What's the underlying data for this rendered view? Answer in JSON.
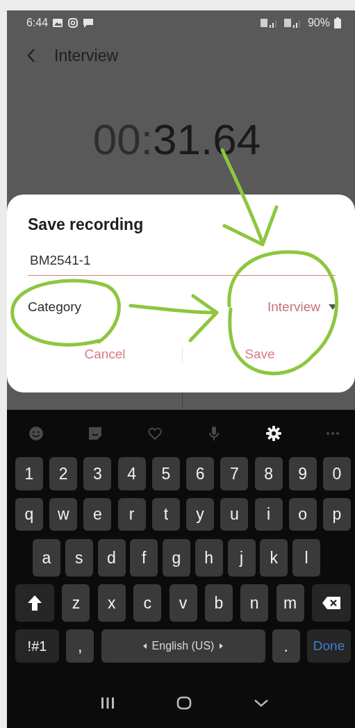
{
  "status_bar": {
    "time": "6:44",
    "battery": "90%"
  },
  "header": {
    "title": "Interview"
  },
  "timer": {
    "dim_part": "00:",
    "main_part": "31.64"
  },
  "dialog": {
    "title": "Save recording",
    "name_field": {
      "value": "BM2541-1"
    },
    "category": {
      "label": "Category",
      "value": "Interview"
    },
    "buttons": [
      "Cancel",
      "Save"
    ]
  },
  "keyboard": {
    "toolbar": [
      {
        "kind": "emoji",
        "highlighted": false
      },
      {
        "kind": "sticker",
        "highlighted": false
      },
      {
        "kind": "heart",
        "highlighted": false
      },
      {
        "kind": "mic",
        "highlighted": false
      },
      {
        "kind": "settings",
        "highlighted": true
      },
      {
        "kind": "more",
        "highlighted": false
      }
    ],
    "rows": [
      {
        "keys": [
          {
            "kind": "char",
            "label": "1"
          },
          {
            "kind": "char",
            "label": "2"
          },
          {
            "kind": "char",
            "label": "3"
          },
          {
            "kind": "char",
            "label": "4"
          },
          {
            "kind": "char",
            "label": "5"
          },
          {
            "kind": "char",
            "label": "6"
          },
          {
            "kind": "char",
            "label": "7"
          },
          {
            "kind": "char",
            "label": "8"
          },
          {
            "kind": "char",
            "label": "9"
          },
          {
            "kind": "char",
            "label": "0"
          }
        ]
      },
      {
        "keys": [
          {
            "kind": "char",
            "label": "q"
          },
          {
            "kind": "char",
            "label": "w"
          },
          {
            "kind": "char",
            "label": "e"
          },
          {
            "kind": "char",
            "label": "r"
          },
          {
            "kind": "char",
            "label": "t"
          },
          {
            "kind": "char",
            "label": "y"
          },
          {
            "kind": "char",
            "label": "u"
          },
          {
            "kind": "char",
            "label": "i"
          },
          {
            "kind": "char",
            "label": "o"
          },
          {
            "kind": "char",
            "label": "p"
          }
        ]
      },
      {
        "keys": [
          {
            "kind": "char",
            "label": "a"
          },
          {
            "kind": "char",
            "label": "s"
          },
          {
            "kind": "char",
            "label": "d"
          },
          {
            "kind": "char",
            "label": "f"
          },
          {
            "kind": "char",
            "label": "g"
          },
          {
            "kind": "char",
            "label": "h"
          },
          {
            "kind": "char",
            "label": "j"
          },
          {
            "kind": "char",
            "label": "k"
          },
          {
            "kind": "char",
            "label": "l"
          }
        ]
      },
      {
        "keys": [
          {
            "kind": "shift"
          },
          {
            "kind": "char",
            "label": "z"
          },
          {
            "kind": "char",
            "label": "x"
          },
          {
            "kind": "char",
            "label": "c"
          },
          {
            "kind": "char",
            "label": "v"
          },
          {
            "kind": "char",
            "label": "b"
          },
          {
            "kind": "char",
            "label": "n"
          },
          {
            "kind": "char",
            "label": "m"
          },
          {
            "kind": "backspace"
          }
        ]
      },
      {
        "keys": [
          {
            "kind": "symbols",
            "label": "!#1"
          },
          {
            "kind": "char",
            "label": ","
          },
          {
            "kind": "space",
            "label": "English (US)"
          },
          {
            "kind": "char",
            "label": "."
          },
          {
            "kind": "done",
            "label": "Done"
          }
        ]
      }
    ]
  },
  "nav_bar": [
    {
      "kind": "recents"
    },
    {
      "kind": "home"
    },
    {
      "kind": "back"
    }
  ]
}
